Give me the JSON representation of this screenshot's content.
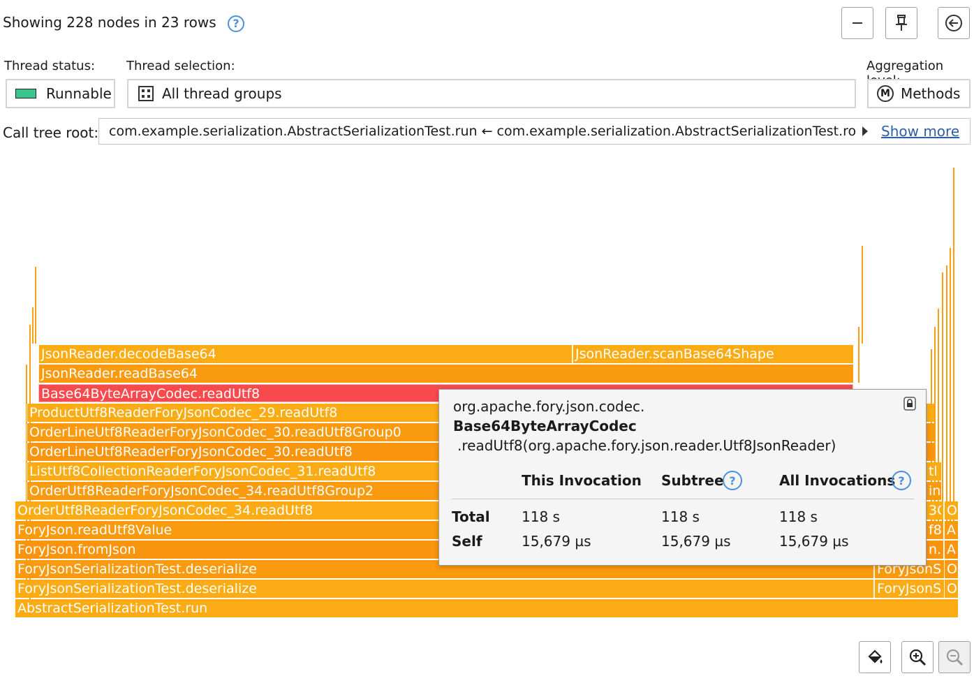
{
  "header": {
    "summary": "Showing 228 nodes in 23 rows",
    "help": "?"
  },
  "toolbar": {
    "collapse_icon": "minus-icon",
    "pin_icon": "pin-icon",
    "back_icon": "back-arrow-icon"
  },
  "filters": {
    "thread_status_label": "Thread status:",
    "thread_status_value": "Runnable",
    "thread_status_color": "#3bc48b",
    "thread_selection_label": "Thread selection:",
    "thread_selection_value": "All thread groups",
    "aggregation_label": "Aggregation level:",
    "aggregation_value": "Methods",
    "aggregation_badge": "M"
  },
  "call_tree_root": {
    "label": "Call tree root:",
    "value": "com.example.serialization.AbstractSerializationTest.run ← com.example.serialization.AbstractSerializationTest.roundT",
    "show_more": "Show more"
  },
  "flame": {
    "rows": [
      {
        "label": "JsonReader.decodeBase64",
        "label2": "JsonReader.scanBase64Shape"
      },
      {
        "label": "JsonReader.readBase64"
      },
      {
        "label": "Base64ByteArrayCodec.readUtf8"
      },
      {
        "label": "ProductUtf8ReaderForyJsonCodec_29.readUtf8"
      },
      {
        "label": "OrderLineUtf8ReaderForyJsonCodec_30.readUtf8Group0"
      },
      {
        "label": "OrderLineUtf8ReaderForyJsonCodec_30.readUtf8"
      },
      {
        "label": "ListUtf8CollectionReaderForyJsonCodec_31.readUtf8"
      },
      {
        "label": "OrderUtf8ReaderForyJsonCodec_34.readUtf8Group2"
      },
      {
        "label": "OrderUtf8ReaderForyJsonCodec_34.readUtf8"
      },
      {
        "label": "ForyJson.readUtf8Value"
      },
      {
        "label": "ForyJson.fromJson"
      },
      {
        "label": "ForyJsonSerializationTest.deserialize",
        "label2": "ForyJsonS",
        "label3": "O"
      },
      {
        "label": "ForyJsonSerializationTest.deserialize",
        "label2": "ForyJsonS",
        "label3": "O"
      },
      {
        "label": "AbstractSerializationTest.run"
      }
    ],
    "right_fragments": [
      "tl",
      "in",
      "3C",
      "f8",
      "n.t"
    ],
    "right_edge": [
      "O",
      "A",
      "A"
    ]
  },
  "tooltip": {
    "package": "org.apache.fory.json.codec.",
    "class_name": "Base64ByteArrayCodec",
    "method": ".readUtf8(org.apache.fory.json.reader.Utf8JsonReader)",
    "col_this": "This Invocation",
    "col_subtree": "Subtree",
    "col_all": "All Invocations",
    "help": "?",
    "row_total": "Total",
    "row_self": "Self",
    "total_this": "118 s",
    "total_subtree": "118 s",
    "total_all": "118 s",
    "self_this": "15,679 µs",
    "self_subtree": "15,679 µs",
    "self_all": "15,679 µs",
    "lock_icon": "lock-icon"
  },
  "bottom_toolbar": {
    "paint_icon": "paint-bucket-icon",
    "zoom_in_icon": "zoom-in-icon",
    "zoom_out_icon": "zoom-out-icon"
  }
}
